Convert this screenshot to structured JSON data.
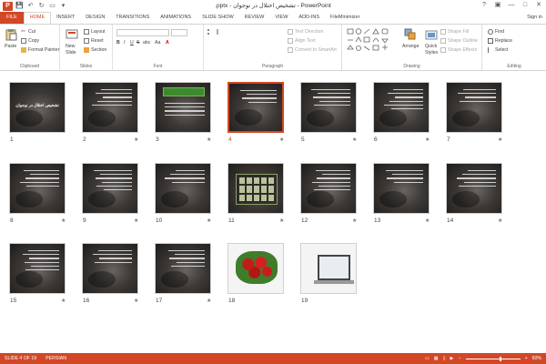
{
  "window": {
    "title": ".pptx - تشخیص اختلال در نوجوان - PowerPoint",
    "app_logo": "P",
    "controls": [
      "?",
      "▣",
      "—",
      "□",
      "✕"
    ]
  },
  "qat": {
    "save": "💾",
    "undo": "↶",
    "redo": "↻",
    "present": "▭",
    "more": "▾"
  },
  "tabs": [
    "FILE",
    "HOME",
    "INSERT",
    "DESIGN",
    "TRANSITIONS",
    "ANIMATIONS",
    "SLIDE SHOW",
    "REVIEW",
    "VIEW",
    "ADD-INS",
    "FileMinimizer"
  ],
  "active_tab": "HOME",
  "signin": "Sign in",
  "ribbon": {
    "clipboard": {
      "paste": "Paste",
      "cut": "Cut",
      "copy": "Copy",
      "format_painter": "Format Painter",
      "label": "Clipboard"
    },
    "slides": {
      "new_slide": "New",
      "new_slide_2": "Slide",
      "layout": "Layout",
      "reset": "Reset",
      "section": "Section",
      "label": "Slides"
    },
    "font": {
      "label": "Font",
      "bold": "B",
      "italic": "I",
      "underline": "U",
      "strike": "S",
      "abc": "abc",
      "aa": "Aa",
      "font_color": "A"
    },
    "paragraph": {
      "text_direction": "Text Direction",
      "align_text": "Align Text",
      "convert_smartart": "Convert to SmartArt",
      "label": "Paragraph"
    },
    "drawing": {
      "arrange": "Arrange",
      "quick_styles": "Quick",
      "quick_styles_2": "Styles",
      "shape_fill": "Shape Fill",
      "shape_outline": "Shape Outline",
      "shape_effects": "Shape Effects",
      "label": "Drawing"
    },
    "editing": {
      "find": "Find",
      "replace": "Replace",
      "select": "Select",
      "label": "Editing"
    }
  },
  "slides": [
    {
      "num": "1",
      "kind": "title",
      "title": "تشخیص اختلال در نوجوان",
      "star": false
    },
    {
      "num": "2",
      "kind": "dark",
      "star": true
    },
    {
      "num": "3",
      "kind": "green",
      "star": true
    },
    {
      "num": "4",
      "kind": "dark",
      "star": true,
      "selected": true
    },
    {
      "num": "5",
      "kind": "dark",
      "star": true
    },
    {
      "num": "6",
      "kind": "dark",
      "star": true
    },
    {
      "num": "7",
      "kind": "dark",
      "star": true
    },
    {
      "num": "8",
      "kind": "dark",
      "star": true
    },
    {
      "num": "9",
      "kind": "dark",
      "star": true
    },
    {
      "num": "10",
      "kind": "dark",
      "star": true
    },
    {
      "num": "11",
      "kind": "calendar",
      "star": true
    },
    {
      "num": "12",
      "kind": "dark",
      "star": true
    },
    {
      "num": "13",
      "kind": "dark",
      "star": true
    },
    {
      "num": "14",
      "kind": "dark",
      "star": true
    },
    {
      "num": "15",
      "kind": "dark",
      "star": true
    },
    {
      "num": "16",
      "kind": "dark",
      "star": true
    },
    {
      "num": "17",
      "kind": "dark",
      "star": true
    },
    {
      "num": "18",
      "kind": "roses",
      "star": false
    },
    {
      "num": "19",
      "kind": "laptop",
      "star": false
    }
  ],
  "star_glyph": "★",
  "status": {
    "slide_of": "SLIDE 4 OF 19",
    "language": "PERSIAN",
    "zoom": "60%",
    "zoom_level": 0.6,
    "zoom_minus": "−",
    "zoom_plus": "+"
  }
}
